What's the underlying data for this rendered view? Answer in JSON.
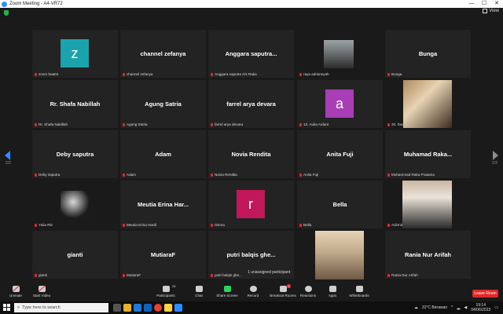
{
  "window": {
    "title": "Zoom Meeting - A4-VR72",
    "minimize": "—",
    "maximize": "☐",
    "close": "✕"
  },
  "topbar": {
    "view_label": "View"
  },
  "pagination": {
    "left": "2/2",
    "right": "2/2"
  },
  "tiles": [
    {
      "name": "zoom baa04",
      "avatar_letter": "z",
      "avatar_color": "#1ba3ad"
    },
    {
      "name": "channel zefanya",
      "center": "channel zefanya"
    },
    {
      "name": "Anggara saputra A/s Raka",
      "center": "Anggara saputra..."
    },
    {
      "name": "raya adriansyah",
      "photo": "street"
    },
    {
      "name": "Bunga",
      "center": "Bunga"
    },
    {
      "name": "Rr. Shafa Nabillah",
      "center": "Rr. Shafa Nabillah"
    },
    {
      "name": "Agung Satria",
      "center": "Agung Satria"
    },
    {
      "name": "farrel arya devara",
      "center": "farrel arya devara"
    },
    {
      "name": "13. Aulia Ardani",
      "avatar_letter": "a",
      "avatar_color": "#a73eb5"
    },
    {
      "name": "20. Daud Syah Fitri Naudiva",
      "photo": "portrait"
    },
    {
      "name": "Deby saputra",
      "center": "Deby saputra"
    },
    {
      "name": "Adam",
      "center": "Adam"
    },
    {
      "name": "Novia Rendita",
      "center": "Novia Rendita"
    },
    {
      "name": "Anita Fuji",
      "center": "Anita Fuji"
    },
    {
      "name": "Muhammad Raka Pratama",
      "center": "Muhamad Raka..."
    },
    {
      "name": "Yulia RD",
      "photo": "girl"
    },
    {
      "name": "Meutia Erina Hardi",
      "center": "Meutia Erina Har..."
    },
    {
      "name": "rimma",
      "avatar_letter": "r",
      "avatar_color": "#c2185b"
    },
    {
      "name": "Bella",
      "center": "Bella"
    },
    {
      "name": "Adzmithara Adrian",
      "photo": "mask"
    },
    {
      "name": "gianti",
      "center": "gianti"
    },
    {
      "name": "MutiaraF",
      "center": "MutiaraF"
    },
    {
      "name": "putri balqis ghe...",
      "center": "putri balqis ghe..."
    },
    {
      "name": "",
      "photo": "beach"
    },
    {
      "name": "Rania Nur Arifah",
      "center": "Rania Nur Arifah"
    }
  ],
  "toast": "1 unassigned participant",
  "toolbar": {
    "unmute": "Unmute",
    "start_video": "Start Video",
    "participants": "Participants",
    "participants_count": "26",
    "chat": "Chat",
    "share_screen": "Share Screen",
    "record": "Record",
    "breakout_rooms": "Breakout Rooms",
    "breakout_badge": "1",
    "reactions": "Reactions",
    "apps": "Apps",
    "whiteboards": "Whiteboards",
    "leave": "Leave Room"
  },
  "taskbar": {
    "search_placeholder": "Type here to search",
    "weather": "31°C Berawan",
    "time": "19:14",
    "date": "04/06/2023"
  }
}
